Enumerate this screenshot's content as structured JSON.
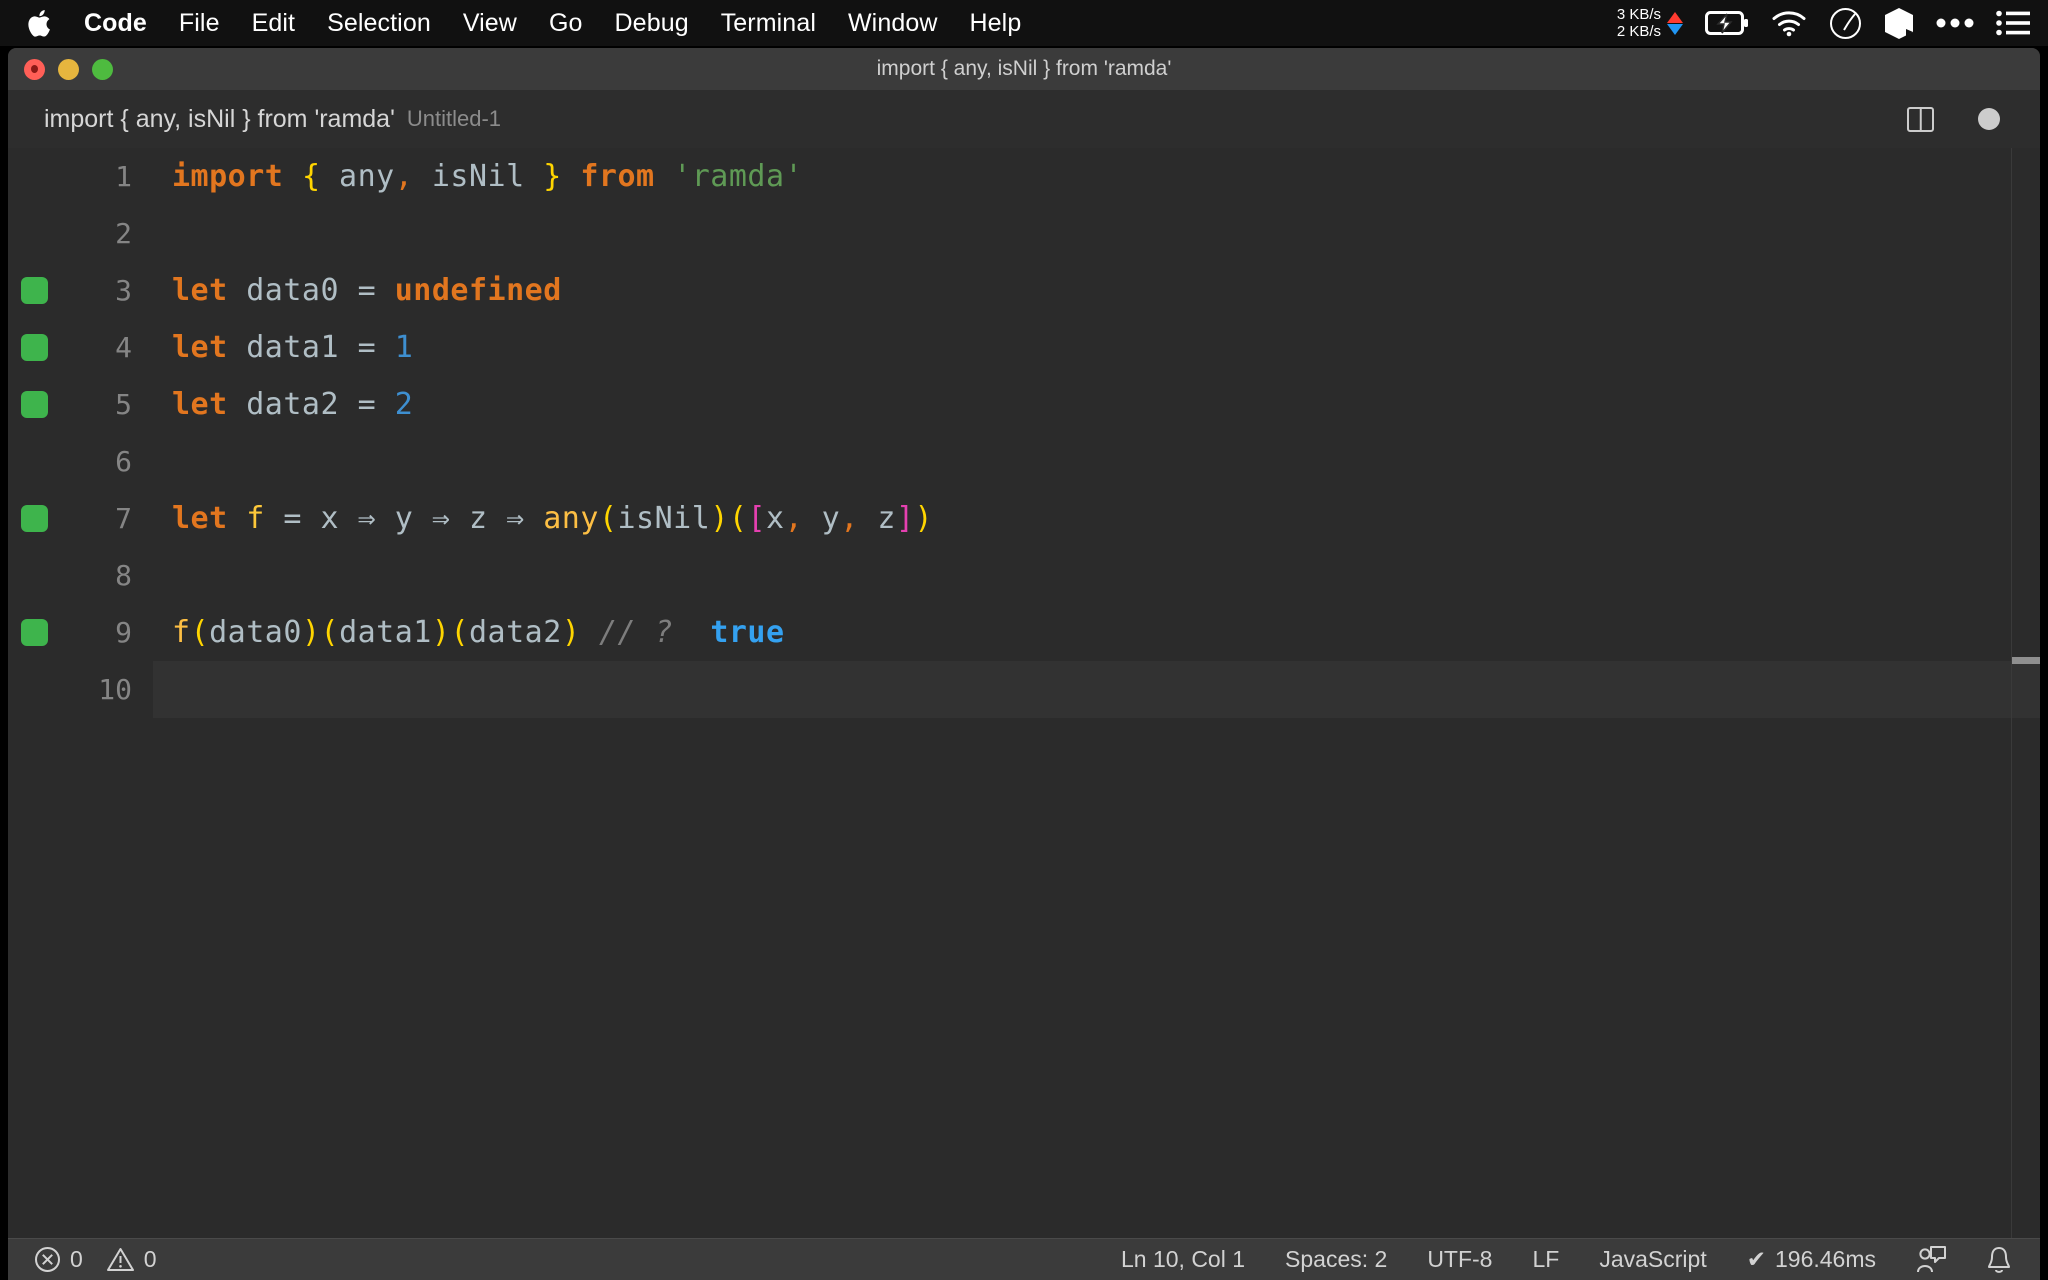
{
  "menubar": {
    "apple_icon": "apple-logo-icon",
    "items": [
      {
        "label": "Code",
        "bold": true
      },
      {
        "label": "File"
      },
      {
        "label": "Edit"
      },
      {
        "label": "Selection"
      },
      {
        "label": "View"
      },
      {
        "label": "Go"
      },
      {
        "label": "Debug"
      },
      {
        "label": "Terminal"
      },
      {
        "label": "Window"
      },
      {
        "label": "Help"
      }
    ],
    "status": {
      "net_up": "3 KB/s",
      "net_down": "2 KB/s",
      "up_arrow_color": "#ff3b30",
      "down_arrow_color": "#2196f3",
      "icons": [
        "battery-charging-icon",
        "wifi-icon",
        "clock-icon",
        "cube-icon",
        "ellipsis-icon",
        "list-icon"
      ]
    }
  },
  "window": {
    "title": "import { any, isNil } from 'ramda'",
    "traffic_lights": [
      "close-button",
      "minimize-button",
      "maximize-button"
    ]
  },
  "tabstrip": {
    "breadcrumb": "import { any, isNil } from 'ramda'",
    "filename": "Untitled-1",
    "actions": [
      "split-editor-icon",
      "unsaved-indicator"
    ]
  },
  "editor": {
    "language": "JavaScript",
    "lines": [
      {
        "num": "1",
        "marker": false,
        "current": false
      },
      {
        "num": "2",
        "marker": false,
        "current": false
      },
      {
        "num": "3",
        "marker": true,
        "current": false
      },
      {
        "num": "4",
        "marker": true,
        "current": false
      },
      {
        "num": "5",
        "marker": true,
        "current": false
      },
      {
        "num": "6",
        "marker": false,
        "current": false
      },
      {
        "num": "7",
        "marker": true,
        "current": false
      },
      {
        "num": "8",
        "marker": false,
        "current": false
      },
      {
        "num": "9",
        "marker": true,
        "current": false
      },
      {
        "num": "10",
        "marker": false,
        "current": true
      }
    ],
    "code_text": {
      "l1": "import { any, isNil } from 'ramda'",
      "l3": "let data0 = undefined",
      "l4": "let data1 = 1",
      "l5": "let data2 = 2",
      "l7": "let f = x ⇒ y ⇒ z ⇒ any(isNil)([x, y, z])",
      "l9": "f(data0)(data1)(data2) // ?  true"
    },
    "tokens": {
      "kw_import": "import",
      "brace_open": "{",
      "id_any": " any",
      "comma1": ",",
      "id_isNil": " isNil ",
      "brace_close": "}",
      "kw_from": " from ",
      "str_ramda": "'ramda'",
      "kw_let": "let",
      "id_data0": " data0 ",
      "eq": "= ",
      "kw_undefined": "undefined",
      "id_data1": " data1 ",
      "num_1": "1",
      "id_data2": " data2 ",
      "num_2": "2",
      "fn_f": " f ",
      "var_x": "x ",
      "arrow": "⇒",
      "var_y": " y ",
      "var_z": " z ",
      "fn_any": "any",
      "paren_open": "(",
      "id_isNil2": "isNil",
      "paren_close": ")",
      "paren_open2": "(",
      "bracket_open": "[",
      "vx": "x",
      "comma_a": ",",
      "vy": " y",
      "comma_b": ",",
      "vz": " z",
      "bracket_close": "]",
      "paren_close2": ")",
      "call_f": "f",
      "call_data0": "data0",
      "call_data1": "data1",
      "call_data2": "data2",
      "comment": "// ?",
      "bool_true": "true"
    },
    "colors": {
      "background": "#2b2b2b",
      "keyword": "#e2761f",
      "string": "#5f9a55",
      "number": "#3e8fd0",
      "brace": "#ffd500",
      "bracket": "#e540b0",
      "function": "#fdbf44",
      "identifier": "#b0bec5",
      "comment": "#7d7d7d",
      "boolean": "#34a1f0",
      "gutter_marker": "#3eb44c",
      "line_number": "#858585"
    }
  },
  "statusbar": {
    "errors_icon": "error-circle-icon",
    "errors": "0",
    "warnings_icon": "warning-triangle-icon",
    "warnings": "0",
    "cursor_position": "Ln 10, Col 1",
    "indentation": "Spaces: 2",
    "encoding": "UTF-8",
    "eol": "LF",
    "language_mode": "JavaScript",
    "runtime_check": "✔",
    "runtime": "196.46ms",
    "feedback_icon": "feedback-person-icon",
    "bell_icon": "bell-icon"
  }
}
